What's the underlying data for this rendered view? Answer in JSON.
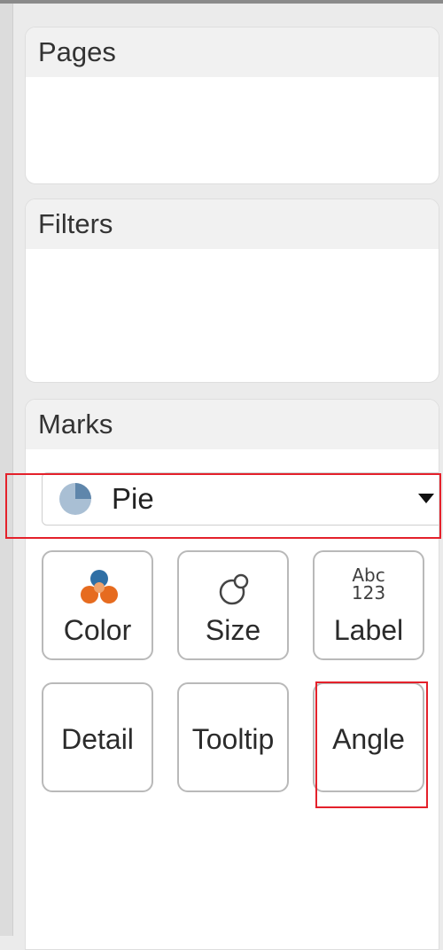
{
  "panels": {
    "pages": {
      "title": "Pages"
    },
    "filters": {
      "title": "Filters"
    },
    "marks": {
      "title": "Marks",
      "mark_type": {
        "selected": "Pie",
        "icon": "pie-icon"
      },
      "buttons": [
        {
          "label": "Color",
          "icon": "color-icon"
        },
        {
          "label": "Size",
          "icon": "size-icon"
        },
        {
          "label": "Label",
          "icon": "label-icon",
          "icon_text_top": "Abc",
          "icon_text_bottom": "123"
        },
        {
          "label": "Detail"
        },
        {
          "label": "Tooltip"
        },
        {
          "label": "Angle"
        }
      ]
    }
  },
  "colors": {
    "highlight": "#e4212b",
    "color_icon_blue": "#2f6fa5",
    "color_icon_orange": "#e66b1f",
    "pie_icon": "#9db5cc"
  }
}
